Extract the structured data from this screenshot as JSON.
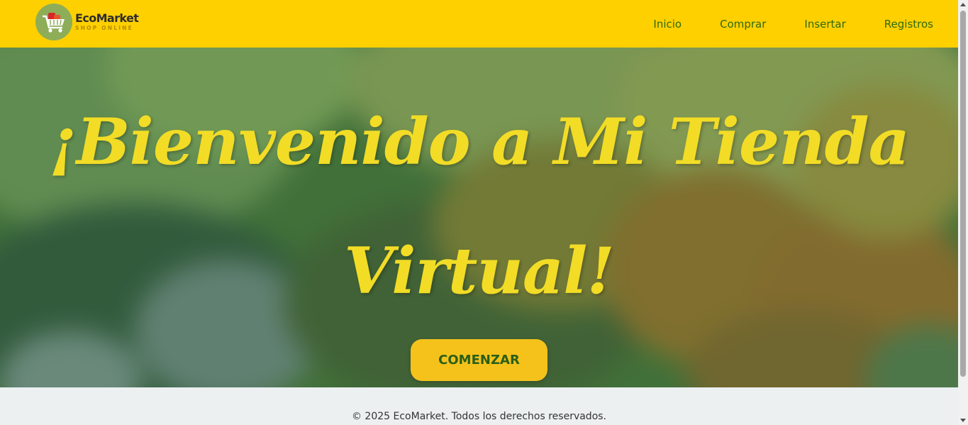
{
  "brand": {
    "name": "EcoMarket",
    "tagline": "SHOP ONLINE"
  },
  "nav": {
    "items": [
      {
        "label": "Inicio"
      },
      {
        "label": "Comprar"
      },
      {
        "label": "Insertar"
      },
      {
        "label": "Registros"
      }
    ]
  },
  "hero": {
    "title": "¡Bienvenido a Mi Tienda Virtual!",
    "cta_label": "COMENZAR"
  },
  "footer": {
    "text": "© 2025 EcoMarket. Todos los derechos reservados."
  },
  "colors": {
    "navbar": "#ffd000",
    "nav_link": "#2d6a12",
    "hero_title": "#f2dc26",
    "cta_background": "#f5c21b",
    "cta_text": "#2a5f18",
    "footer_background": "#ecf0f1"
  },
  "icons": {
    "logo": "shopping-cart-icon"
  }
}
